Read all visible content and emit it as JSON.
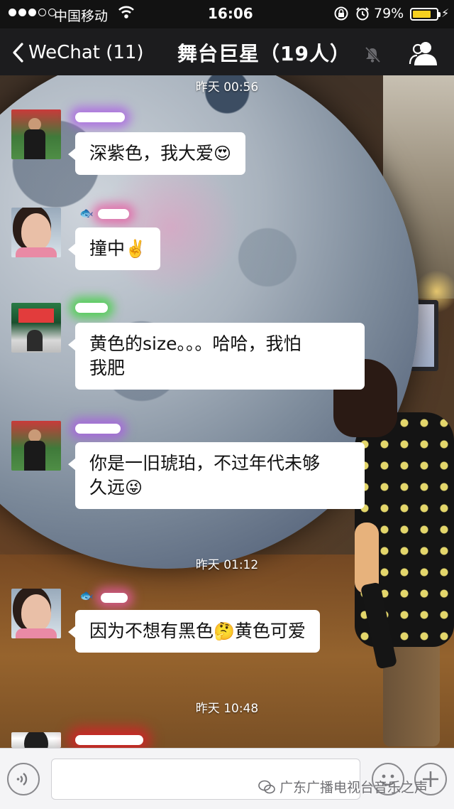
{
  "status_bar": {
    "carrier": "中国移动",
    "time": "16:06",
    "battery_percent": "79%",
    "battery_level": 0.79,
    "accent_color": "#f5d020"
  },
  "nav": {
    "back_label": "WeChat (11)",
    "title": "舞台巨星（19人）",
    "icons": [
      "back-chevron-icon",
      "mute-bell-icon",
      "group-members-icon"
    ]
  },
  "chat": {
    "timestamps": [
      "昨天 00:56",
      "昨天 01:12",
      "昨天 10:48"
    ],
    "messages": [
      {
        "text": "深紫色，我大爱",
        "emoji": "😍"
      },
      {
        "text": "撞中",
        "emoji": "✌️"
      },
      {
        "text_line1": "黄色的size。。。哈哈，我怕",
        "text_line2": "我肥"
      },
      {
        "text_line1": "你是一旧琥珀，不过年代未够",
        "text_line2": "久远",
        "emoji": "😜"
      },
      {
        "text_a": "因为不想有黑色",
        "emoji": "🤔",
        "text_b": "黄色可爱"
      }
    ]
  },
  "input_bar": {
    "watermark": "广东广播电视台音乐之声",
    "icons": [
      "voice-icon",
      "emoji-icon",
      "plus-icon"
    ]
  }
}
